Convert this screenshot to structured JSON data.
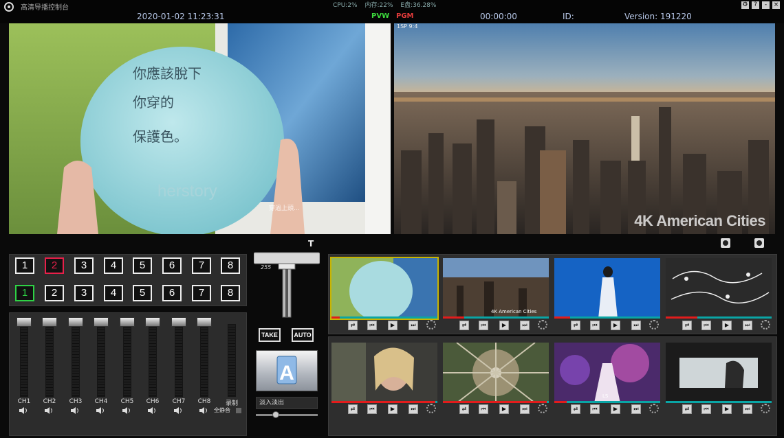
{
  "app": {
    "title": "高清导播控制台",
    "cpu": "CPU:2%",
    "memory": "内存:22%",
    "disk": "E盘:36.28%",
    "datetime": "2020-01-02   11:23:31",
    "pvw_label": "PVW",
    "pgm_label": "PGM",
    "timecode": "00:00:00",
    "id_label": "ID:",
    "version": "Version: 191220",
    "window_buttons": [
      "⚙",
      "?",
      "-",
      "×"
    ]
  },
  "monitors": {
    "pvw": {
      "balloon_text": [
        "你應該脫下",
        "你穿的",
        "保護色。"
      ],
      "brand": "herstory",
      "subtitle": "穿過上頭..."
    },
    "pgm": {
      "tag": "1SP 9:4",
      "watermark": "4K American Cities"
    }
  },
  "channels": {
    "pgm_row": [
      "1",
      "2",
      "3",
      "4",
      "5",
      "6",
      "7",
      "8"
    ],
    "pvw_row": [
      "1",
      "2",
      "3",
      "4",
      "5",
      "6",
      "7",
      "8"
    ],
    "pgm_active_index": 1,
    "pvw_active_index": 0
  },
  "mixer": {
    "channels": [
      "CH1",
      "CH2",
      "CH3",
      "CH4",
      "CH5",
      "CH6",
      "CH7",
      "CH8",
      "录制"
    ],
    "mute_all": "全静音"
  },
  "transition": {
    "tbar_label": "T",
    "tbar_value": "255",
    "take": "TAKE",
    "auto": "AUTO",
    "effect": "淡入淡出",
    "preview_letter": "A"
  },
  "sources": {
    "row1": [
      {
        "name": "herstory balloon",
        "selected": true,
        "progress": 0.08
      },
      {
        "name": "4K American Cities",
        "caption": "4K American Cities",
        "progress": 0.2
      },
      {
        "name": "bluescreen dancer",
        "progress": 0.15
      },
      {
        "name": "music notes",
        "progress": 0.3
      }
    ],
    "row2": [
      {
        "name": "actress closeup",
        "progress": 0.98
      },
      {
        "name": "aerial star",
        "progress": 0.98
      },
      {
        "name": "concert stage",
        "caption": "LS",
        "progress": 0.12
      },
      {
        "name": "cinema scene",
        "progress": 0.0
      }
    ]
  },
  "colors": {
    "pvw": "#2ed245",
    "pgm": "#e8204a",
    "progress": "#e21c1c",
    "track": "#0aa5a5"
  }
}
